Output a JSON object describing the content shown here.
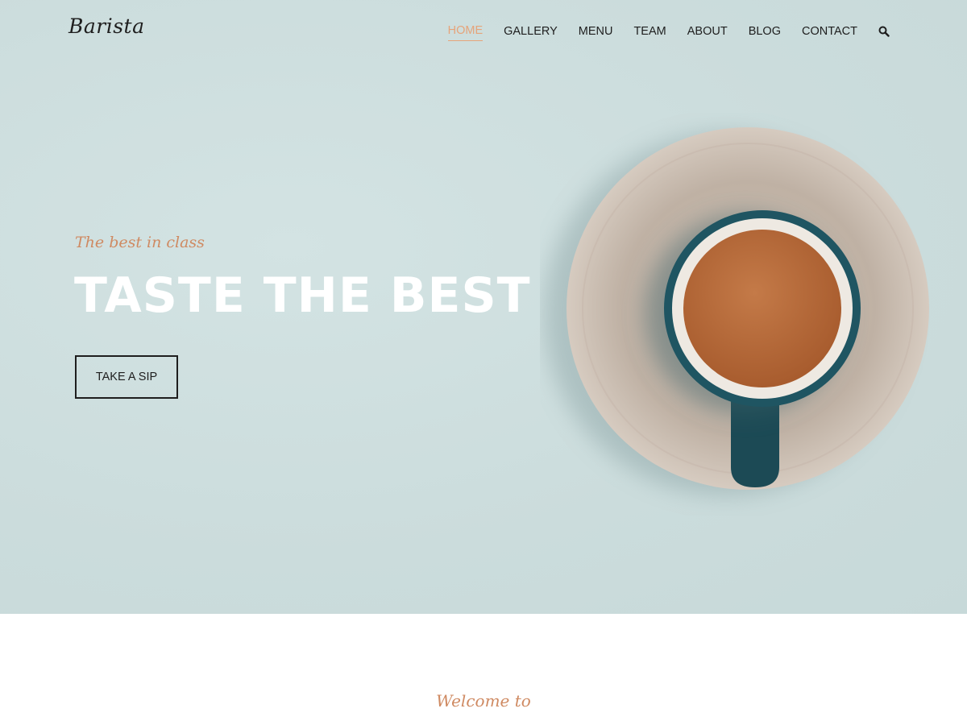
{
  "brand": {
    "logo_text": "Barista"
  },
  "nav": {
    "items": [
      {
        "label": "HOME",
        "active": true
      },
      {
        "label": "GALLERY",
        "active": false
      },
      {
        "label": "MENU",
        "active": false
      },
      {
        "label": "TEAM",
        "active": false
      },
      {
        "label": "ABOUT",
        "active": false
      },
      {
        "label": "BLOG",
        "active": false
      },
      {
        "label": "CONTACT",
        "active": false
      }
    ],
    "search_icon": "search-icon"
  },
  "hero": {
    "tagline": "The best in class",
    "headline": "TASTE THE BEST",
    "cta_label": "TAKE A SIP",
    "background_color": "#cddfe0"
  },
  "intro": {
    "welcome_text": "Welcome to"
  },
  "colors": {
    "accent": "#e6a47a",
    "script_accent": "#cf8a62",
    "text_dark": "#1e1e1e"
  }
}
